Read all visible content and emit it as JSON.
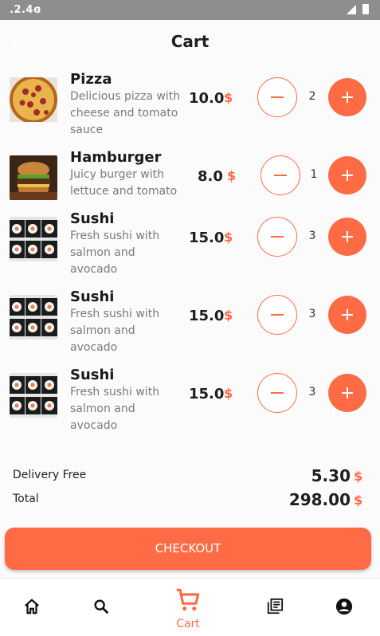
{
  "status_bar": {
    "time": ".2.4ɞ"
  },
  "header": {
    "title": "Cart"
  },
  "cart": {
    "items": [
      {
        "name": "Pizza",
        "description": "Delicious pizza with cheese and tomato sauce",
        "price": "10.0",
        "currency": "$",
        "quantity": "2",
        "image_icon": "pizza-photo"
      },
      {
        "name": "Hamburger",
        "description": "Juicy burger with lettuce and tomato",
        "price": "8.0",
        "currency": "$",
        "quantity": "1",
        "image_icon": "burger-photo"
      },
      {
        "name": "Sushi",
        "description": "Fresh sushi with salmon and avocado",
        "price": "15.0",
        "currency": "$",
        "quantity": "3",
        "image_icon": "sushi-photo"
      },
      {
        "name": "Sushi",
        "description": "Fresh sushi with salmon and avocado",
        "price": "15.0",
        "currency": "$",
        "quantity": "3",
        "image_icon": "sushi-photo"
      },
      {
        "name": "Sushi",
        "description": "Fresh sushi with salmon and avocado",
        "price": "15.0",
        "currency": "$",
        "quantity": "3",
        "image_icon": "sushi-photo"
      }
    ]
  },
  "summary": {
    "delivery_label": "Delivery Free",
    "delivery_value": "5.30",
    "total_label": "Total",
    "total_value": "298.00",
    "currency": "$"
  },
  "checkout": {
    "label": "CHECKOUT"
  },
  "bottom_nav": {
    "items": [
      {
        "icon": "home-icon"
      },
      {
        "icon": "search-icon"
      },
      {
        "icon": "cart-icon",
        "label": "Cart",
        "active": true
      },
      {
        "icon": "library-books-icon"
      },
      {
        "icon": "account-circle-icon"
      }
    ]
  },
  "colors": {
    "accent": "#ff6b45",
    "text": "#1e1e1e",
    "muted": "#7a7a7a",
    "status_bar": "#8e8e8e"
  }
}
